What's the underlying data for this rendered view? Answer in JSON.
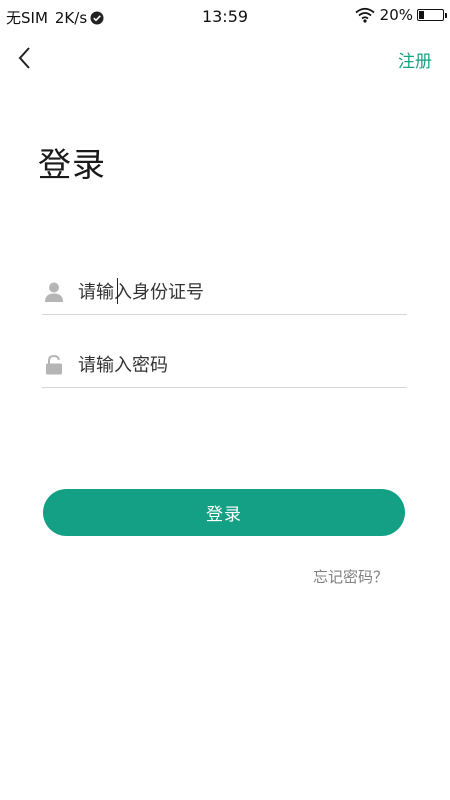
{
  "status_bar": {
    "carrier": "无SIM",
    "speed": "2K/s",
    "time": "13:59",
    "battery_percent": "20%",
    "battery_level": 0.2,
    "icons": [
      "check-circle-icon",
      "wifi-icon",
      "battery-icon"
    ]
  },
  "nav": {
    "back_icon": "chevron-left-icon",
    "register_label": "注册"
  },
  "title": "登录",
  "form": {
    "id_field": {
      "icon": "user-icon",
      "placeholder": "请输入身份证号",
      "value": ""
    },
    "password_field": {
      "icon": "lock-icon",
      "placeholder": "请输入密码",
      "value": ""
    }
  },
  "login_button_label": "登录",
  "forgot_password_label": "忘记密码？",
  "colors": {
    "accent": "#14a085",
    "register_link": "#1aa084",
    "icon_gray": "#b5b5b5",
    "forgot_gray": "#808080"
  }
}
